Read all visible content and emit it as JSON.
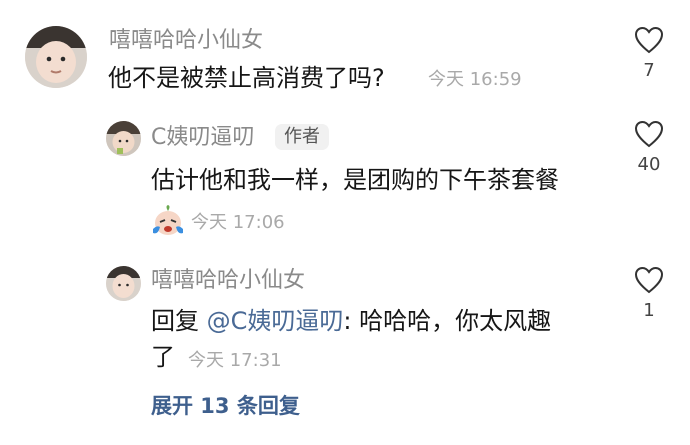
{
  "comments": [
    {
      "username": "嘻嘻哈哈小仙女",
      "text": "他不是被禁止高消费了吗?",
      "time": "今天 16:59",
      "likes": "7"
    },
    {
      "username": "C姨叨逼叨",
      "badge": "作者",
      "text": "估计他和我一样，是团购的下午茶套餐",
      "time": "今天 17:06",
      "likes": "40",
      "emoji_icon": "crying-laughing-baby-emoji"
    },
    {
      "username": "嘻嘻哈哈小仙女",
      "reply_prefix": "回复",
      "mention": "@C姨叨逼叨",
      "text_line1": ": 哈哈哈，你太风趣",
      "text_line2": "了",
      "time": "今天 17:31",
      "likes": "1"
    }
  ],
  "expand_replies": "展开 13 条回复",
  "colors": {
    "username": "#8a8a8a",
    "text": "#161616",
    "time": "#a9a9a9",
    "mention": "#4a6a96",
    "expand": "#3e5f8d"
  },
  "icons": {
    "like": "heart-outline-icon"
  }
}
